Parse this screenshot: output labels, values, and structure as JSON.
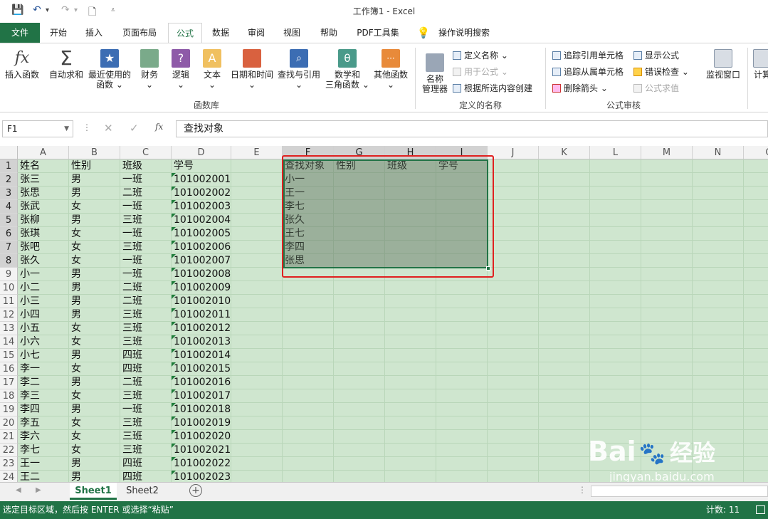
{
  "title": "工作簿1  -  Excel",
  "tabs": [
    "文件",
    "开始",
    "插入",
    "页面布局",
    "公式",
    "数据",
    "审阅",
    "视图",
    "帮助",
    "PDF工具集",
    "操作说明搜索"
  ],
  "active_tab": "公式",
  "ribbon": {
    "insert_function": "插入函数",
    "autosum": "自动求和",
    "recent_1": "最近使用的",
    "recent_2": "函数",
    "financial": "财务",
    "logical": "逻辑",
    "text": "文本",
    "datetime": "日期和时间",
    "lookup": "查找与引用",
    "math_1": "数学和",
    "math_2": "三角函数",
    "other": "其他函数",
    "group_library": "函数库",
    "name_mgr_1": "名称",
    "name_mgr_2": "管理器",
    "define_name": "定义名称",
    "use_in_formula": "用于公式",
    "create_from_sel": "根据所选内容创建",
    "group_names": "定义的名称",
    "trace_precedents": "追踪引用单元格",
    "trace_dependents": "追踪从属单元格",
    "remove_arrows": "删除箭头",
    "show_formulas": "显示公式",
    "error_checking": "错误检查",
    "evaluate_formula": "公式求值",
    "group_audit": "公式审核",
    "watch_window": "监视窗口",
    "calc": "计算"
  },
  "formula_bar": {
    "name_box": "F1",
    "fx": "fx",
    "content": "查找对象"
  },
  "columns": [
    "A",
    "B",
    "C",
    "D",
    "E",
    "F",
    "G",
    "H",
    "I",
    "J",
    "K",
    "L",
    "M",
    "N",
    "O"
  ],
  "selected_columns": [
    "F",
    "G",
    "H",
    "I"
  ],
  "selected_rows": [
    1,
    2,
    3,
    4,
    5,
    6,
    7,
    8
  ],
  "rows": [
    {
      "n": "1",
      "a": "姓名",
      "b": "性别",
      "c": "班级",
      "d": "学号",
      "f": "查找对象",
      "g": "性别",
      "h": "班级",
      "i": "学号"
    },
    {
      "n": "2",
      "a": "张三",
      "b": "男",
      "c": "一班",
      "d": "101002001",
      "f": "小一"
    },
    {
      "n": "3",
      "a": "张思",
      "b": "男",
      "c": "二班",
      "d": "101002002",
      "f": "王一"
    },
    {
      "n": "4",
      "a": "张武",
      "b": "女",
      "c": "一班",
      "d": "101002003",
      "f": "李七"
    },
    {
      "n": "5",
      "a": "张柳",
      "b": "男",
      "c": "三班",
      "d": "101002004",
      "f": "张久"
    },
    {
      "n": "6",
      "a": "张琪",
      "b": "女",
      "c": "一班",
      "d": "101002005",
      "f": "王七"
    },
    {
      "n": "7",
      "a": "张吧",
      "b": "女",
      "c": "三班",
      "d": "101002006",
      "f": "李四"
    },
    {
      "n": "8",
      "a": "张久",
      "b": "女",
      "c": "一班",
      "d": "101002007",
      "f": "张思"
    },
    {
      "n": "9",
      "a": "小一",
      "b": "男",
      "c": "一班",
      "d": "101002008"
    },
    {
      "n": "10",
      "a": "小二",
      "b": "男",
      "c": "二班",
      "d": "101002009"
    },
    {
      "n": "11",
      "a": "小三",
      "b": "男",
      "c": "二班",
      "d": "101002010"
    },
    {
      "n": "12",
      "a": "小四",
      "b": "男",
      "c": "三班",
      "d": "101002011"
    },
    {
      "n": "13",
      "a": "小五",
      "b": "女",
      "c": "三班",
      "d": "101002012"
    },
    {
      "n": "14",
      "a": "小六",
      "b": "女",
      "c": "三班",
      "d": "101002013"
    },
    {
      "n": "15",
      "a": "小七",
      "b": "男",
      "c": "四班",
      "d": "101002014"
    },
    {
      "n": "16",
      "a": "李一",
      "b": "女",
      "c": "四班",
      "d": "101002015"
    },
    {
      "n": "17",
      "a": "李二",
      "b": "男",
      "c": "二班",
      "d": "101002016"
    },
    {
      "n": "18",
      "a": "李三",
      "b": "女",
      "c": "三班",
      "d": "101002017"
    },
    {
      "n": "19",
      "a": "李四",
      "b": "男",
      "c": "一班",
      "d": "101002018"
    },
    {
      "n": "20",
      "a": "李五",
      "b": "女",
      "c": "三班",
      "d": "101002019"
    },
    {
      "n": "21",
      "a": "李六",
      "b": "女",
      "c": "三班",
      "d": "101002020"
    },
    {
      "n": "22",
      "a": "李七",
      "b": "女",
      "c": "三班",
      "d": "101002021"
    },
    {
      "n": "23",
      "a": "王一",
      "b": "男",
      "c": "四班",
      "d": "101002022"
    },
    {
      "n": "24",
      "a": "王二",
      "b": "男",
      "c": "四班",
      "d": "101002023"
    }
  ],
  "sheets": [
    "Sheet1",
    "Sheet2"
  ],
  "active_sheet": "Sheet1",
  "status": {
    "message": "选定目标区域，然后按 ENTER 或选择“粘贴”",
    "count": "计数: 11"
  },
  "watermark": {
    "brand": "Bai",
    "brand2": "经验",
    "url": "jingyan.baidu.com"
  },
  "colors": {
    "excel_green": "#217346",
    "grid_fill": "#cfe6cf",
    "highlight": "#e02020"
  }
}
